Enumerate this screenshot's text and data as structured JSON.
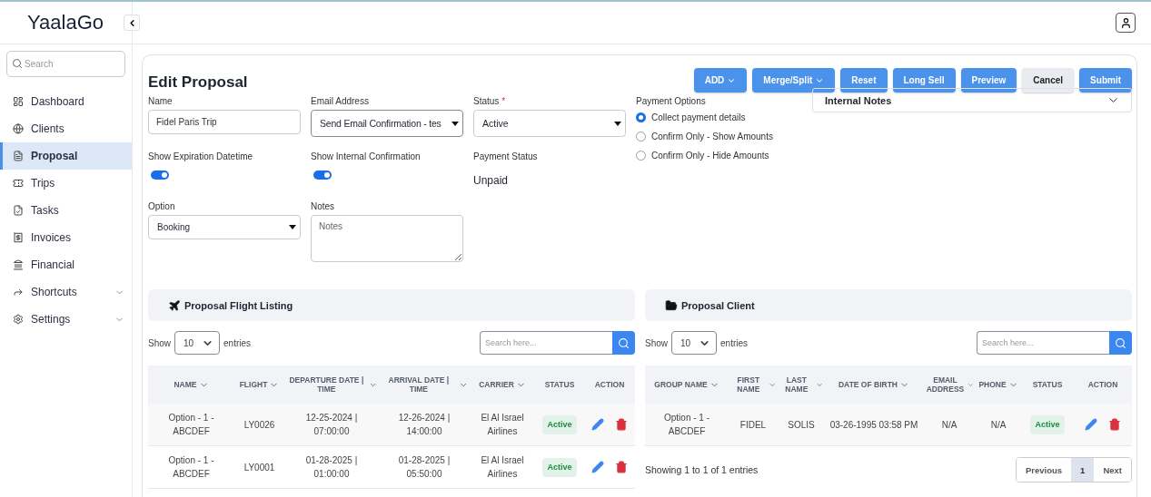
{
  "header": {
    "logo": "YaalaGo"
  },
  "sidebar": {
    "search": {
      "placeholder": "Search"
    },
    "items": [
      {
        "label": "Dashboard",
        "selected": false,
        "expandable": false
      },
      {
        "label": "Clients",
        "selected": false,
        "expandable": false
      },
      {
        "label": "Proposal",
        "selected": true,
        "expandable": false
      },
      {
        "label": "Trips",
        "selected": false,
        "expandable": false
      },
      {
        "label": "Tasks",
        "selected": false,
        "expandable": false
      },
      {
        "label": "Invoices",
        "selected": false,
        "expandable": false
      },
      {
        "label": "Financial",
        "selected": false,
        "expandable": false
      },
      {
        "label": "Shortcuts",
        "selected": false,
        "expandable": true
      },
      {
        "label": "Settings",
        "selected": false,
        "expandable": true
      }
    ]
  },
  "page": {
    "title": "Edit Proposal",
    "buttons": [
      {
        "label": "ADD",
        "kind": "primary",
        "dropdown": true
      },
      {
        "label": "Merge/Split",
        "kind": "primary",
        "dropdown": true
      },
      {
        "label": "Reset",
        "kind": "primary",
        "dropdown": false
      },
      {
        "label": "Long Sell",
        "kind": "primary",
        "dropdown": false
      },
      {
        "label": "Preview",
        "kind": "primary",
        "dropdown": false
      },
      {
        "label": "Cancel",
        "kind": "secondary",
        "dropdown": false
      },
      {
        "label": "Submit",
        "kind": "primary",
        "dropdown": false
      }
    ]
  },
  "form": {
    "name": {
      "label": "Name",
      "value": "Fidel Paris Trip"
    },
    "email": {
      "label": "Email Address",
      "value": "Send Email Confirmation - tes"
    },
    "status": {
      "label": "Status",
      "required_mark": "*",
      "value": "Active"
    },
    "show_expiration": {
      "label": "Show Expiration Datetime",
      "on": true
    },
    "show_internal": {
      "label": "Show Internal Confirmation",
      "on": true
    },
    "payment_status": {
      "label": "Payment Status",
      "value": "Unpaid"
    },
    "option": {
      "label": "Option",
      "value": "Booking"
    },
    "notes": {
      "label": "Notes",
      "placeholder": "Notes"
    },
    "payment_options": {
      "label": "Payment Options",
      "choices": [
        {
          "label": "Collect payment details",
          "selected": true
        },
        {
          "label": "Confirm Only - Show Amounts",
          "selected": false
        },
        {
          "label": "Confirm Only - Hide Amounts",
          "selected": false
        }
      ]
    },
    "internal_notes": {
      "title": "Internal Notes",
      "expanded": false
    }
  },
  "flight_listing": {
    "title": "Proposal Flight Listing",
    "show": "Show",
    "page_size": "10",
    "entries": "entries",
    "search": {
      "placeholder": "Search here..."
    },
    "columns": [
      {
        "label": "NAME",
        "sortable": true
      },
      {
        "label": "FLIGHT",
        "sortable": true
      },
      {
        "label": "DEPARTURE DATE | TIME",
        "sortable": true
      },
      {
        "label": "ARRIVAL DATE | TIME",
        "sortable": true
      },
      {
        "label": "CARRIER",
        "sortable": true
      },
      {
        "label": "STATUS",
        "sortable": false
      },
      {
        "label": "ACTION",
        "sortable": false
      }
    ],
    "rows": [
      {
        "cells": [
          "Option - 1 - ABCDEF",
          "LY0026",
          "12-25-2024 | 07:00:00",
          "12-26-2024 | 14:00:00",
          "El Al Israel Airlines"
        ],
        "status": "Active"
      },
      {
        "cells": [
          "Option - 1 - ABCDEF",
          "LY0001",
          "01-28-2025 | 01:00:00",
          "01-28-2025 | 05:50:00",
          "El Al Israel Airlines"
        ],
        "status": "Active"
      }
    ]
  },
  "proposal_client": {
    "title": "Proposal Client",
    "show": "Show",
    "page_size": "10",
    "entries": "entries",
    "search": {
      "placeholder": "Search here..."
    },
    "columns": [
      {
        "label": "GROUP NAME",
        "sortable": true
      },
      {
        "label": "FIRST NAME",
        "sortable": true
      },
      {
        "label": "LAST NAME",
        "sortable": true
      },
      {
        "label": "DATE OF BIRTH",
        "sortable": true
      },
      {
        "label": "EMAIL ADDRESS",
        "sortable": true
      },
      {
        "label": "PHONE",
        "sortable": true
      },
      {
        "label": "STATUS",
        "sortable": false
      },
      {
        "label": "ACTION",
        "sortable": false
      }
    ],
    "rows": [
      {
        "cells": [
          "Option - 1 - ABCDEF",
          "FIDEL",
          "SOLIS",
          "03-26-1995 03:58 PM",
          "N/A",
          "N/A"
        ],
        "status": "Active"
      }
    ],
    "info": "Showing 1 to 1 of 1 entries",
    "pagination": [
      {
        "label": "Previous",
        "selected": false
      },
      {
        "label": "1",
        "selected": true
      },
      {
        "label": "Next",
        "selected": false
      }
    ]
  }
}
